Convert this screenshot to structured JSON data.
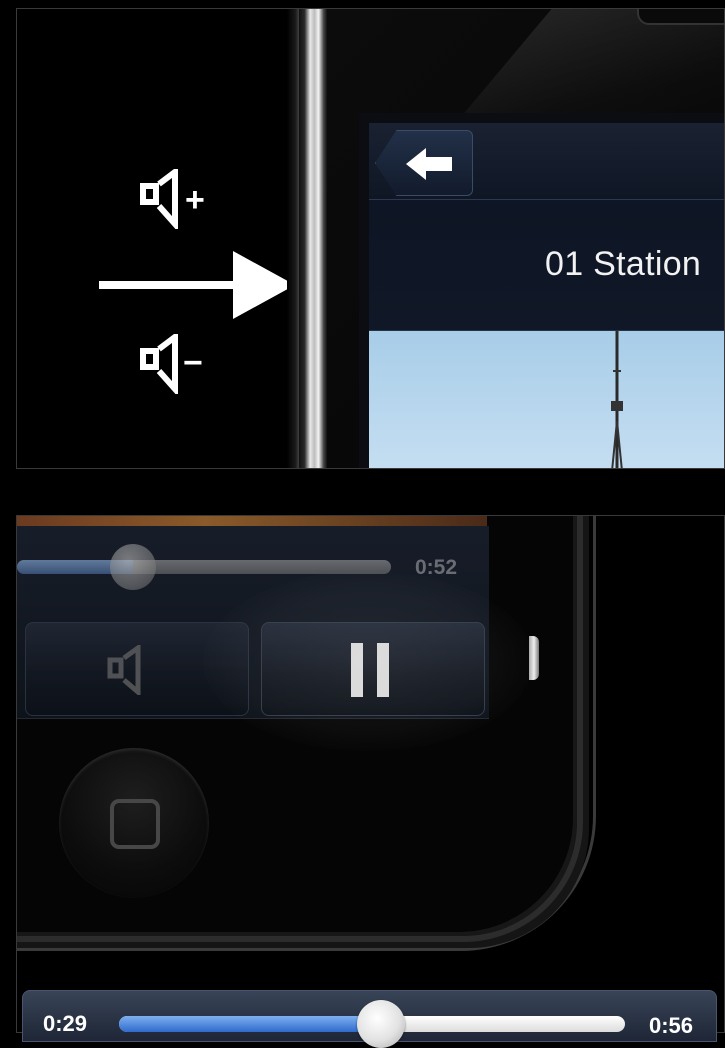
{
  "top_panel": {
    "volume_up_symbol": "+",
    "volume_down_symbol": "−",
    "screen": {
      "back_button_icon": "left-arrow-icon",
      "station_title": "01 Station"
    }
  },
  "bottom_panel": {
    "mini_player": {
      "time_remaining": "0:52",
      "progress_fraction": 0.31
    },
    "mute_button_icon": "speaker-icon",
    "pause_button_icon": "pause-icon",
    "home_button_icon": "home-square-icon"
  },
  "scrubber": {
    "elapsed": "0:29",
    "total": "0:56",
    "progress_fraction": 0.518
  },
  "colors": {
    "accent_blue": "#2f6bcc",
    "sky": "#bcd9ef",
    "navbar": "#1a2232"
  }
}
